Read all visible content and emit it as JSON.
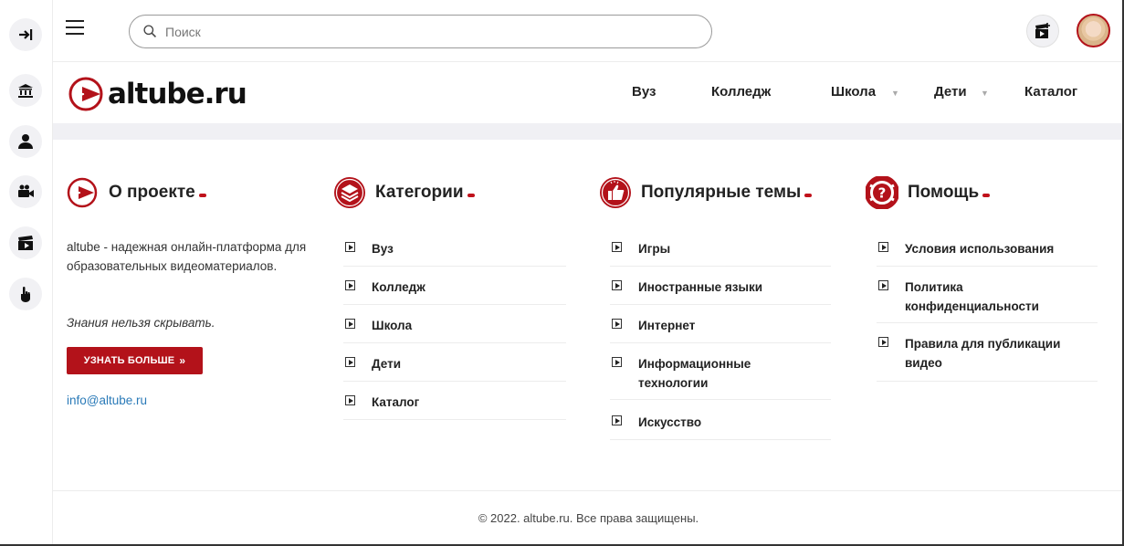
{
  "topbar": {
    "search_placeholder": "Поиск"
  },
  "logo": {
    "text": "altube.ru"
  },
  "nav": {
    "items": [
      {
        "label": "Вуз"
      },
      {
        "label": "Колледж"
      },
      {
        "label": "Школа"
      },
      {
        "label": "Дети"
      },
      {
        "label": "Каталог"
      }
    ]
  },
  "sidebar": {
    "icons": [
      "login-icon",
      "university-icon",
      "user-icon",
      "video-camera-icon",
      "clapperboard-icon",
      "pointer-icon"
    ]
  },
  "about": {
    "title": "О проекте",
    "text": "altube - надежная онлайн-платформа для образовательных видеоматериалов.",
    "motto": "Знания нельзя скрывать.",
    "button": "УЗНАТЬ БОЛЬШЕ",
    "email": "info@altube.ru"
  },
  "categories": {
    "title": "Категории",
    "items": [
      "Вуз",
      "Колледж",
      "Школа",
      "Дети",
      "Каталог"
    ]
  },
  "popular": {
    "title": "Популярные темы",
    "items": [
      "Игры",
      "Иностранные языки",
      "Интернет",
      "Информационные технологии",
      "Искусство"
    ]
  },
  "help": {
    "title": "Помощь",
    "items": [
      "Условия использования",
      "Политика конфиденциальности",
      "Правила для публикации видео"
    ]
  },
  "footer": {
    "copyright": "© 2022. altube.ru. Все права защищены."
  },
  "colors": {
    "accent": "#b3121a",
    "link": "#2a7ab8"
  }
}
